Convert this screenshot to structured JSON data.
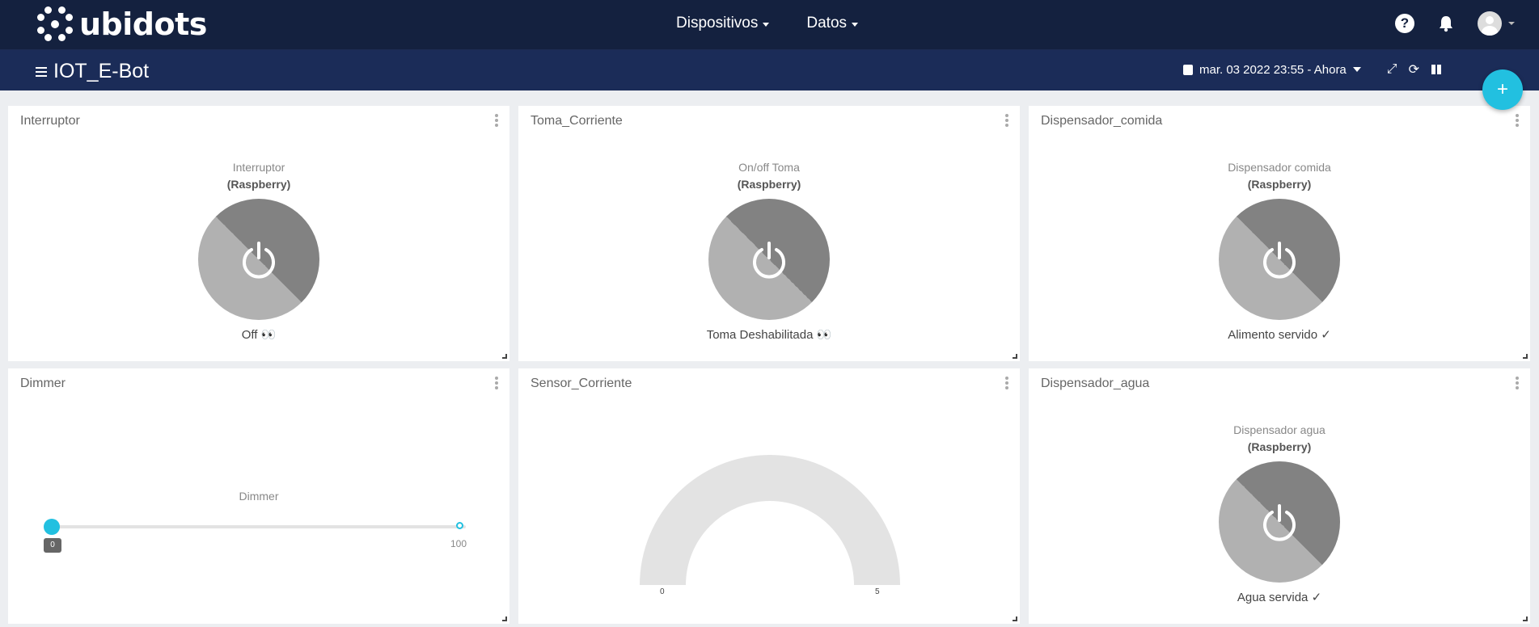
{
  "header": {
    "brand": "ubidots",
    "nav": [
      {
        "label": "Dispositivos"
      },
      {
        "label": "Datos"
      }
    ],
    "help_glyph": "?"
  },
  "subheader": {
    "dashboard_title": "IOT_E-Bot",
    "date_range": "mar. 03 2022 23:55 - Ahora"
  },
  "fab": {
    "label": "+"
  },
  "widgets": {
    "interruptor": {
      "title": "Interruptor",
      "label": "Interruptor",
      "device": "(Raspberry)",
      "status": "Off 👀"
    },
    "toma": {
      "title": "Toma_Corriente",
      "label": "On/off Toma",
      "device": "(Raspberry)",
      "status": "Toma Deshabilitada 👀"
    },
    "comida": {
      "title": "Dispensador_comida",
      "label": "Dispensador comida",
      "device": "(Raspberry)",
      "status": "Alimento servido ✓"
    },
    "dimmer": {
      "title": "Dimmer",
      "label": "Dimmer",
      "value": "0",
      "max": "100"
    },
    "sensor": {
      "title": "Sensor_Corriente",
      "min": "0",
      "max": "5"
    },
    "agua": {
      "title": "Dispensador_agua",
      "label": "Dispensador agua",
      "device": "(Raspberry)",
      "status": "Agua servida ✓"
    }
  },
  "colors": {
    "topbar": "#14213f",
    "subbar": "#1b2c58",
    "accent": "#22c0e0",
    "switch_light": "#b1b1b1",
    "switch_dark": "#828282",
    "gauge": "#e3e3e3"
  }
}
